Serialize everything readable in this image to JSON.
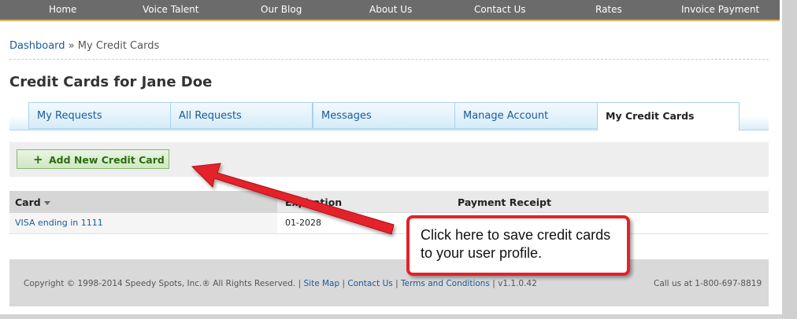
{
  "nav": {
    "items": [
      "Home",
      "Voice Talent",
      "Our Blog",
      "About Us",
      "Contact Us",
      "Rates",
      "Invoice Payment"
    ]
  },
  "breadcrumb": {
    "home": "Dashboard",
    "separator": "»",
    "current": "My Credit Cards"
  },
  "page": {
    "title": "Credit Cards for Jane Doe"
  },
  "tabs": [
    {
      "label": "My Requests",
      "active": false
    },
    {
      "label": "All Requests",
      "active": false
    },
    {
      "label": "Messages",
      "active": false
    },
    {
      "label": "Manage Account",
      "active": false
    },
    {
      "label": "My Credit Cards",
      "active": true
    }
  ],
  "toolbar": {
    "add_label": "Add New Credit Card",
    "add_icon": "plus-icon"
  },
  "table": {
    "columns": [
      "Card",
      "Expiration",
      "Payment Receipt"
    ],
    "sorted_column": "Card",
    "rows": [
      {
        "card": "VISA ending in 1111",
        "expiration": "01-2028",
        "receipt": ""
      }
    ]
  },
  "footer": {
    "copyright": "Copyright © 1998-2014 Speedy Spots, Inc.® All Rights Reserved.",
    "links": [
      "Site Map",
      "Contact Us",
      "Terms and Conditions"
    ],
    "sep": "|",
    "version": "v1.1.0.42",
    "call": "Call us at 1-800-697-8819"
  },
  "callout": {
    "text": "Click here to save credit cards to your user profile."
  },
  "colors": {
    "nav_bg": "#6b6b6b",
    "link": "#1a5a9c",
    "button_text": "#2b6b13",
    "callout_border": "#e3222a"
  }
}
